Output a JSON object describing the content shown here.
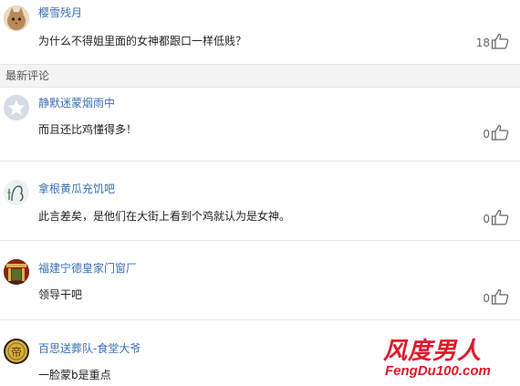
{
  "top_comment": {
    "author": "樱雪残月",
    "text": "为什么不得姐里面的女神都跟口一样低贱？",
    "likes": "18"
  },
  "section": {
    "title": "最新评论"
  },
  "comments": [
    {
      "author": "静默迷蒙烟雨中",
      "text": "而且还比鸡懂得多！",
      "likes": "0",
      "avatar": "default-avatar"
    },
    {
      "author": "拿根黄瓜充饥吧",
      "text": "此言差矣，是他们在大街上看到个鸡就认为是女神。",
      "likes": "0",
      "avatar": "sketch-avatar"
    },
    {
      "author": "福建宁德皇家门窗厂",
      "text": "领导干吧",
      "likes": "0",
      "avatar": "gate-avatar"
    },
    {
      "author": "百思送葬队-食堂大爷",
      "text": "一脸蒙b是重点",
      "likes": "",
      "avatar": "coin-avatar"
    }
  ],
  "watermark": {
    "title": "风度男人",
    "subtitle": "FengDu100.com"
  },
  "colors": {
    "author": "#3b6fb5",
    "watermark": "#e0182d",
    "section_bg": "#f4f4f4"
  }
}
